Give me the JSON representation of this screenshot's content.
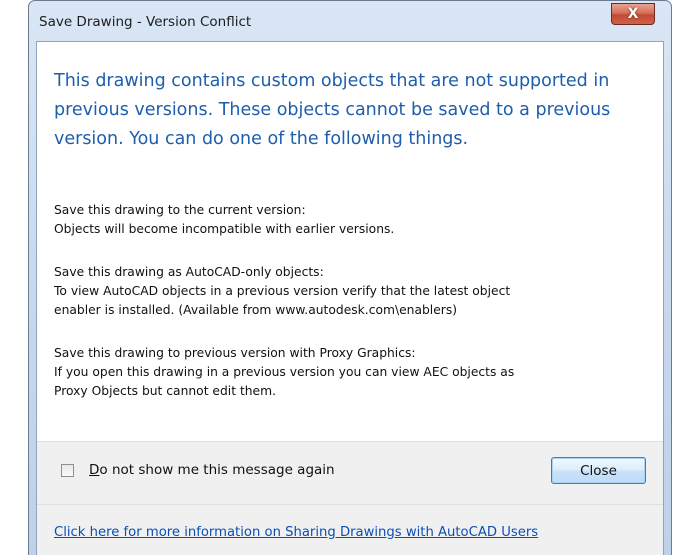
{
  "window": {
    "title": "Save Drawing - Version Conflict",
    "close_glyph": "X"
  },
  "heading": "This drawing contains custom objects that are not supported in previous versions. These objects cannot be saved to a previous version. You can do one of the following things.",
  "sections": [
    {
      "lines": [
        "Save this drawing to the current version:",
        "Objects will become incompatible with earlier versions."
      ]
    },
    {
      "lines": [
        "Save this drawing as AutoCAD-only objects:",
        "To view AutoCAD objects in a previous version verify that the latest object",
        "enabler is installed. (Available from www.autodesk.com\\enablers)"
      ]
    },
    {
      "lines": [
        "Save this drawing to previous version with Proxy Graphics:",
        "If you open this drawing in a previous version you can view AEC objects as",
        "Proxy Objects but cannot edit them."
      ]
    }
  ],
  "footer": {
    "checkbox": {
      "mnemonic": "D",
      "label_rest": "o not show me this message again",
      "checked": false
    },
    "close_button": "Close",
    "info_link": "Click here for more information on Sharing Drawings with AutoCAD Users"
  },
  "colors": {
    "heading": "#1e5eab",
    "link": "#0b4fb4",
    "close_x": "#c24a35"
  }
}
